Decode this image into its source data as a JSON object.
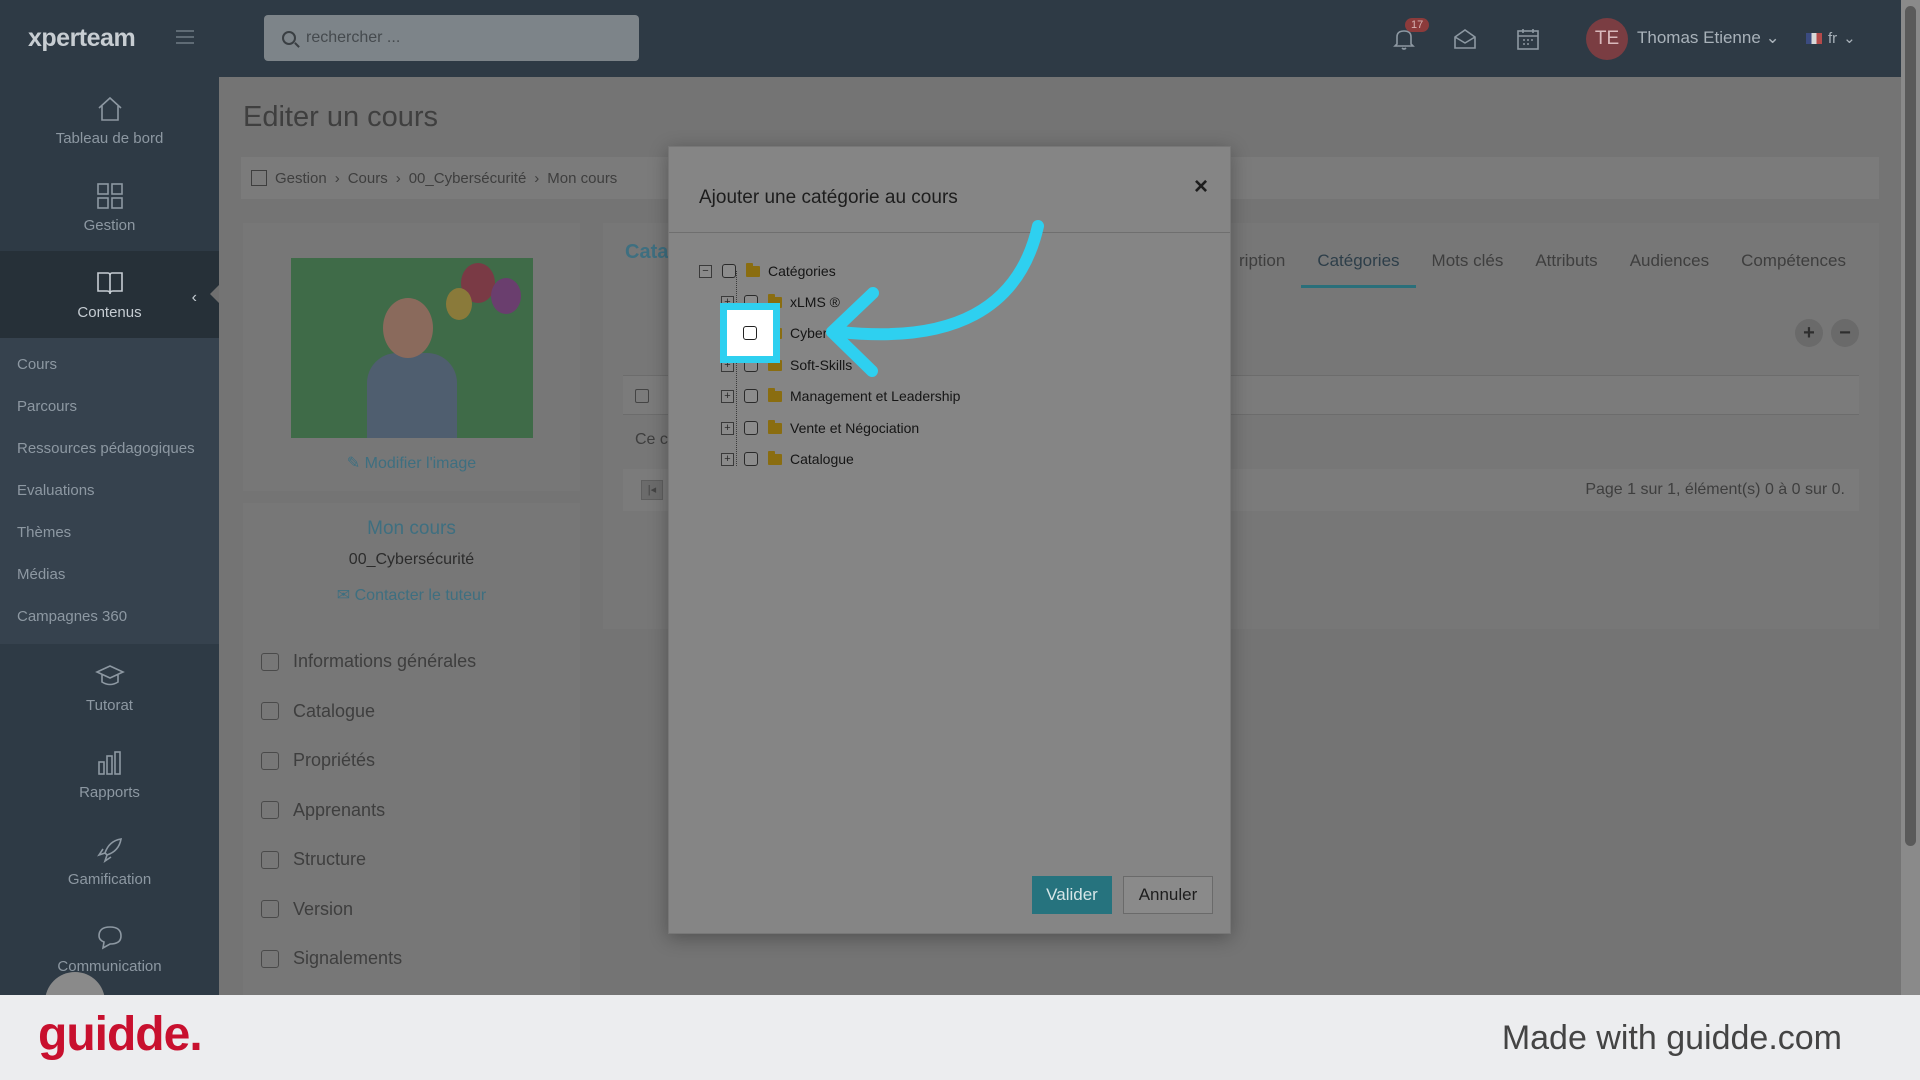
{
  "app": {
    "logo": "xperteam"
  },
  "sidebar": {
    "nav_top": [
      {
        "label": "Tableau de bord",
        "icon": "home-icon"
      },
      {
        "label": "Gestion",
        "icon": "grid-icon"
      },
      {
        "label": "Contenus",
        "icon": "book-icon",
        "active": true
      }
    ],
    "sub_items": [
      "Cours",
      "Parcours",
      "Ressources pédagogiques",
      "Evaluations",
      "Thèmes",
      "Médias",
      "Campagnes 360"
    ],
    "nav_bottom": [
      {
        "label": "Tutorat",
        "icon": "graduation-cap-icon"
      },
      {
        "label": "Rapports",
        "icon": "bar-chart-icon"
      },
      {
        "label": "Gamification",
        "icon": "rocket-icon"
      },
      {
        "label": "Communication",
        "icon": "chat-icon"
      }
    ]
  },
  "topbar": {
    "search_placeholder": "rechercher ...",
    "notif_count": "17",
    "avatar_initials": "TE",
    "user_name": "Thomas Etienne",
    "lang": "fr"
  },
  "page": {
    "title": "Editer un cours",
    "breadcrumb": [
      "Gestion",
      "Cours",
      "00_Cybersécurité",
      "Mon cours"
    ]
  },
  "course": {
    "edit_image": "Modifier l'image",
    "name": "Mon cours",
    "category": "00_Cybersécurité",
    "contact": "Contacter le tuteur",
    "menu": [
      "Informations générales",
      "Catalogue",
      "Propriétés",
      "Apprenants",
      "Structure",
      "Version",
      "Signalements"
    ]
  },
  "panel": {
    "title_partial": "Cata",
    "tabs": [
      "ription",
      "Catégories",
      "Mots clés",
      "Attributs",
      "Audiences",
      "Compétences"
    ],
    "active_tab": "Catégories",
    "empty_partial": "Ce c",
    "pager_info": "Page 1 sur 1, élément(s) 0 à 0 sur 0."
  },
  "modal": {
    "title": "Ajouter une catégorie au cours",
    "root": "Catégories",
    "nodes": [
      "xLMS ®",
      "Cyber",
      "Soft-Skills",
      "Management et Leadership",
      "Vente et Négociation",
      "Catalogue"
    ],
    "validate": "Valider",
    "cancel": "Annuler"
  },
  "footer": {
    "brand": "guidde.",
    "made_with": "Made with guidde.com"
  },
  "colors": {
    "highlight": "#2ed0f0",
    "primary_button": "#26737e",
    "brand_red": "#c8102e"
  }
}
